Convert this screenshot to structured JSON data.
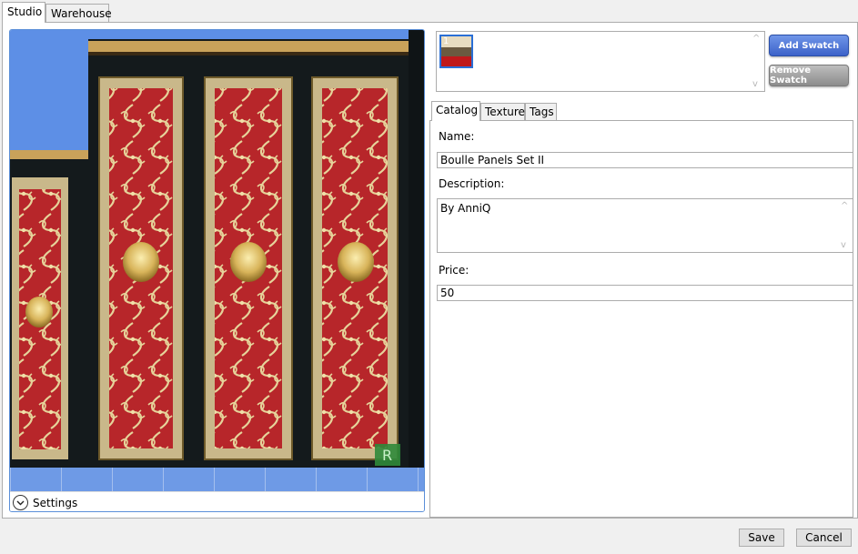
{
  "top_tabs": [
    {
      "label": "Studio",
      "active": true
    },
    {
      "label": "Warehouse",
      "active": false
    }
  ],
  "preview": {
    "settings_label": "Settings",
    "watermark": "R",
    "colors": {
      "sky": "#5d8fe6",
      "frame": "#141a1c",
      "panel": "#c9b88a",
      "inlay": "#9a2a14",
      "gold": "#d8b45a"
    }
  },
  "swatches": {
    "items": [
      {
        "index": "1",
        "colors": [
          "#e8dcc0",
          "#6b5a40",
          "#c0191b"
        ],
        "selected": true
      }
    ],
    "scroll_up": "^",
    "scroll_down": "v",
    "add_label": "Add Swatch",
    "remove_label": "Remove Swatch"
  },
  "inner_tabs": [
    {
      "label": "Catalog",
      "active": true
    },
    {
      "label": "Texture",
      "active": false
    },
    {
      "label": "Tags",
      "active": false
    }
  ],
  "catalog": {
    "name_label": "Name:",
    "name_value": "Boulle Panels Set II",
    "description_label": "Description:",
    "description_value": "By AnniQ",
    "price_label": "Price:",
    "price_value": "50"
  },
  "footer": {
    "save_label": "Save",
    "cancel_label": "Cancel"
  }
}
